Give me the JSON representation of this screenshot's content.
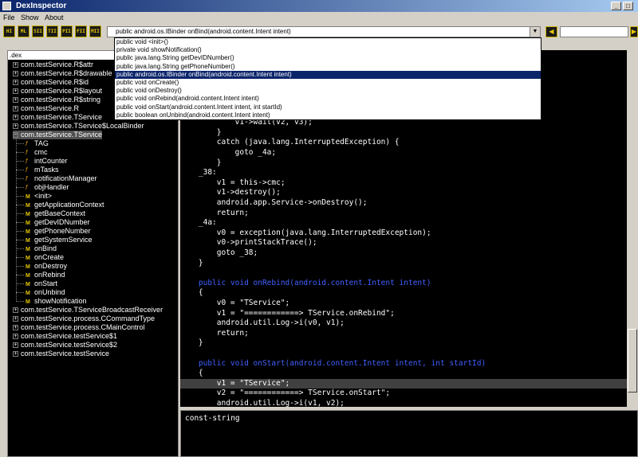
{
  "window": {
    "title": "DexInspector"
  },
  "menu": [
    "File",
    "Show",
    "About"
  ],
  "toolbar": {
    "buttons": [
      "HI",
      "ML",
      "SII",
      "TII",
      "PII",
      "FII",
      "MII"
    ],
    "nav_prev": "◀",
    "nav_next": "▶",
    "method_selector_value": "public android.os.IBinder onBind(android.content.Intent intent)"
  },
  "dropdown": {
    "items": [
      "public void <init>()",
      "private void showNotification()",
      "public java.lang.String getDevIDNumber()",
      "public java.lang.String getPhoneNumber()",
      "public android.os.IBinder onBind(android.content.Intent intent)",
      "public void onCreate()",
      "public void onDestroy()",
      "public void onRebind(android.content.Intent intent)",
      "public void onStart(android.content.Intent intent, int startId)",
      "public boolean onUnbind(android.content.Intent intent)"
    ],
    "selected_index": 4
  },
  "tree": {
    "header": ".dex",
    "nodes": [
      {
        "label": "com.testService.R$attr",
        "kind": "pkg",
        "depth": 0
      },
      {
        "label": "com.testService.R$drawable",
        "kind": "pkg",
        "depth": 0
      },
      {
        "label": "com.testService.R$id",
        "kind": "pkg",
        "depth": 0
      },
      {
        "label": "com.testService.R$layout",
        "kind": "pkg",
        "depth": 0
      },
      {
        "label": "com.testService.R$string",
        "kind": "pkg",
        "depth": 0
      },
      {
        "label": "com.testService.R",
        "kind": "pkg",
        "depth": 0
      },
      {
        "label": "com.testService.TService",
        "kind": "pkg",
        "depth": 0
      },
      {
        "label": "com.testService.TService$LocalBinder",
        "kind": "pkg",
        "depth": 0
      },
      {
        "label": "com.testService.TService",
        "kind": "open",
        "depth": 0
      },
      {
        "label": "TAG",
        "kind": "field",
        "depth": 1
      },
      {
        "label": "cmc",
        "kind": "field",
        "depth": 1
      },
      {
        "label": "intCounter",
        "kind": "field",
        "depth": 1
      },
      {
        "label": "mTasks",
        "kind": "field",
        "depth": 1
      },
      {
        "label": "notificationManager",
        "kind": "field",
        "depth": 1
      },
      {
        "label": "objHandler",
        "kind": "field",
        "depth": 1
      },
      {
        "label": "<init>",
        "kind": "method",
        "depth": 1
      },
      {
        "label": "getApplicationContext",
        "kind": "method",
        "depth": 1
      },
      {
        "label": "getBaseContext",
        "kind": "method",
        "depth": 1
      },
      {
        "label": "getDevIDNumber",
        "kind": "method",
        "depth": 1
      },
      {
        "label": "getPhoneNumber",
        "kind": "method",
        "depth": 1
      },
      {
        "label": "getSystemService",
        "kind": "method",
        "depth": 1
      },
      {
        "label": "onBind",
        "kind": "method",
        "depth": 1
      },
      {
        "label": "onCreate",
        "kind": "method",
        "depth": 1
      },
      {
        "label": "onDestroy",
        "kind": "method",
        "depth": 1
      },
      {
        "label": "onRebind",
        "kind": "method",
        "depth": 1
      },
      {
        "label": "onStart",
        "kind": "method",
        "depth": 1
      },
      {
        "label": "onUnbind",
        "kind": "method",
        "depth": 1
      },
      {
        "label": "showNotification",
        "kind": "method",
        "depth": 1
      },
      {
        "label": "com.testService.TServiceBroadcastReceiver",
        "kind": "pkg",
        "depth": 0
      },
      {
        "label": "com.testService.process.CCommandType",
        "kind": "pkg",
        "depth": 0
      },
      {
        "label": "com.testService.process.CMainControl",
        "kind": "pkg",
        "depth": 0
      },
      {
        "label": "com.testService.testService$1",
        "kind": "pkg",
        "depth": 0
      },
      {
        "label": "com.testService.testService$2",
        "kind": "pkg",
        "depth": 0
      },
      {
        "label": "com.testService.testService",
        "kind": "pkg",
        "depth": 0
      }
    ]
  },
  "code": {
    "lines": [
      {
        "text": "",
        "style": ""
      },
      {
        "text": "",
        "style": ""
      },
      {
        "text": "",
        "style": ""
      },
      {
        "text": "",
        "style": ""
      },
      {
        "text": "",
        "style": ""
      },
      {
        "text": "",
        "style": ""
      },
      {
        "text": "",
        "style": ""
      },
      {
        "text": "            v1->wait(v2, v3);",
        "style": ""
      },
      {
        "text": "        }",
        "style": ""
      },
      {
        "text": "        catch (java.lang.InterruptedException) {",
        "style": ""
      },
      {
        "text": "            goto _4a;",
        "style": ""
      },
      {
        "text": "        }",
        "style": ""
      },
      {
        "text": "    _38:",
        "style": ""
      },
      {
        "text": "        v1 = this->cmc;",
        "style": ""
      },
      {
        "text": "        v1->destroy();",
        "style": ""
      },
      {
        "text": "        android.app.Service->onDestroy();",
        "style": ""
      },
      {
        "text": "        return;",
        "style": ""
      },
      {
        "text": "    _4a:",
        "style": ""
      },
      {
        "text": "        v0 = exception(java.lang.InterruptedException);",
        "style": ""
      },
      {
        "text": "        v0->printStackTrace();",
        "style": ""
      },
      {
        "text": "        goto _38;",
        "style": ""
      },
      {
        "text": "    }",
        "style": ""
      },
      {
        "text": "",
        "style": ""
      },
      {
        "text": "    public void onRebind(android.content.Intent intent)",
        "style": "kw"
      },
      {
        "text": "    {",
        "style": ""
      },
      {
        "text": "        v0 = \"TService\";",
        "style": ""
      },
      {
        "text": "        v1 = \"============> TService.onRebind\";",
        "style": ""
      },
      {
        "text": "        android.util.Log->i(v0, v1);",
        "style": ""
      },
      {
        "text": "        return;",
        "style": ""
      },
      {
        "text": "    }",
        "style": ""
      },
      {
        "text": "",
        "style": ""
      },
      {
        "text": "    public void onStart(android.content.Intent intent, int startId)",
        "style": "kw"
      },
      {
        "text": "    {",
        "style": ""
      },
      {
        "text": "        v1 = \"TService\";",
        "style": "hlrow"
      },
      {
        "text": "        v2 = \"============> TService.onStart\";",
        "style": ""
      },
      {
        "text": "        android.util.Log->i(v1, v2);",
        "style": ""
      }
    ]
  },
  "status": {
    "text": "const-string"
  }
}
